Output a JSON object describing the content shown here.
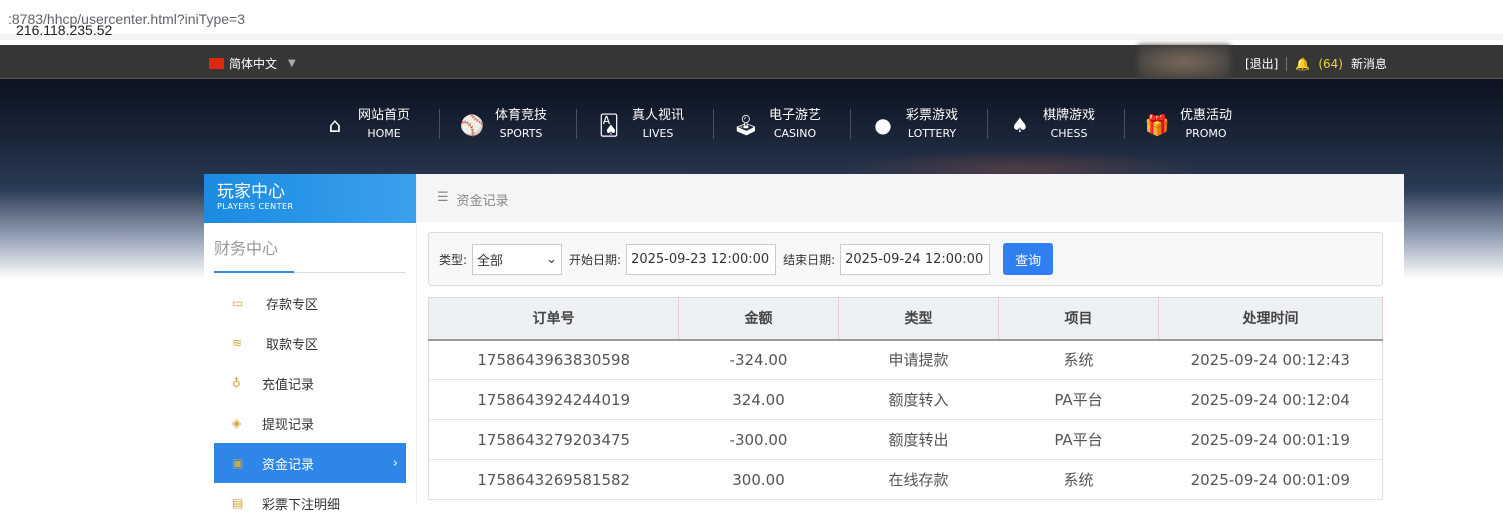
{
  "browser": {
    "url_host": "216.118.235.52",
    "url_rest": ":8783/hhcp/usercenter.html?iniType=3"
  },
  "topbar": {
    "language": "简体中文",
    "logout": "[退出]",
    "message_count": "(64)",
    "messages_label": "新消息"
  },
  "nav": [
    {
      "cn": "网站首页",
      "en": "HOME",
      "icon": "home-icon",
      "glyph": "⌂"
    },
    {
      "cn": "体育竞技",
      "en": "SPORTS",
      "icon": "ball-icon",
      "glyph": "⚾"
    },
    {
      "cn": "真人视讯",
      "en": "LIVES",
      "icon": "cards-icon",
      "glyph": "🂡"
    },
    {
      "cn": "电子游艺",
      "en": "CASINO",
      "icon": "joystick-icon",
      "glyph": "🕹"
    },
    {
      "cn": "彩票游戏",
      "en": "LOTTERY",
      "icon": "lottery-balls-icon",
      "glyph": "●"
    },
    {
      "cn": "棋牌游戏",
      "en": "CHESS",
      "icon": "spade-icon",
      "glyph": "♠"
    },
    {
      "cn": "优惠活动",
      "en": "PROMO",
      "icon": "gift-icon",
      "glyph": "🎁"
    }
  ],
  "sidebar": {
    "title": "玩家中心",
    "subtitle": "PLAYERS CENTER",
    "section": "财务中心",
    "items": [
      {
        "label": "存款专区",
        "icon": "card-icon"
      },
      {
        "label": "取款专区",
        "icon": "hand-money-icon"
      },
      {
        "label": "充值记录",
        "icon": "money-bag-icon"
      },
      {
        "label": "提现记录",
        "icon": "wallet-icon"
      },
      {
        "label": "资金记录",
        "icon": "house-icon",
        "active": true
      },
      {
        "label": "彩票下注明细",
        "icon": "list-icon"
      }
    ]
  },
  "main": {
    "breadcrumb": "资金记录",
    "filter": {
      "type_label": "类型:",
      "type_value": "全部",
      "start_label": "开始日期:",
      "start_value": "2025-09-23 12:00:00",
      "end_label": "结束日期:",
      "end_value": "2025-09-24 12:00:00",
      "search": "查询"
    },
    "table": {
      "columns": [
        "订单号",
        "金额",
        "类型",
        "项目",
        "处理时间"
      ],
      "rows": [
        [
          "1758643963830598",
          "-324.00",
          "申请提款",
          "系统",
          "2025-09-24 00:12:43"
        ],
        [
          "1758643924244019",
          "324.00",
          "额度转入",
          "PA平台",
          "2025-09-24 00:12:04"
        ],
        [
          "1758643279203475",
          "-300.00",
          "额度转出",
          "PA平台",
          "2025-09-24 00:01:19"
        ],
        [
          "1758643269581582",
          "300.00",
          "在线存款",
          "系统",
          "2025-09-24 00:01:09"
        ]
      ]
    }
  },
  "colors": {
    "accent": "#2e87e6",
    "topbar": "#363636",
    "count": "#e8d640"
  }
}
